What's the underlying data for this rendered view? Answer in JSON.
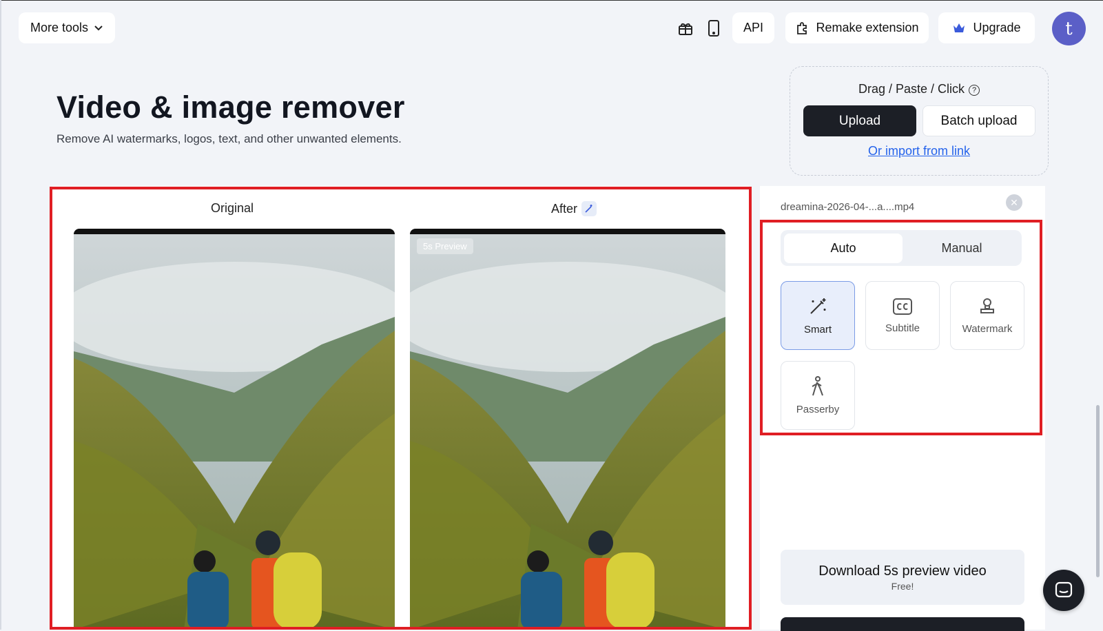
{
  "header": {
    "more_tools": "More tools",
    "api": "API",
    "remake_extension": "Remake extension",
    "upgrade": "Upgrade",
    "avatar_letter": "t",
    "icons": [
      "gift-icon",
      "phone-icon",
      "puzzle-icon",
      "crown-icon",
      "chevron-down-icon"
    ]
  },
  "hero": {
    "title": "Video & image remover",
    "subtitle": "Remove AI watermarks, logos, text, and other unwanted elements."
  },
  "upload": {
    "drag_text": "Drag / Paste / Click",
    "upload_label": "Upload",
    "batch_label": "Batch upload",
    "import_link": "Or import from link"
  },
  "preview": {
    "original_label": "Original",
    "after_label": "After",
    "preview_badge": "5s Preview"
  },
  "side": {
    "file_name": "dreamina-2026-04-...a....mp4",
    "tabs": [
      {
        "label": "Auto",
        "active": true
      },
      {
        "label": "Manual",
        "active": false
      }
    ],
    "tools": [
      {
        "label": "Smart",
        "active": true
      },
      {
        "label": "Subtitle",
        "active": false
      },
      {
        "label": "Watermark",
        "active": false
      },
      {
        "label": "Passerby",
        "active": false
      }
    ],
    "download_label": "Download 5s preview video",
    "download_sub": "Free!"
  },
  "colors": {
    "accent_blue": "#2563eb",
    "highlight_red": "#e01e24",
    "avatar_purple": "#5b5fc7",
    "dark_button": "#1c1f26"
  }
}
